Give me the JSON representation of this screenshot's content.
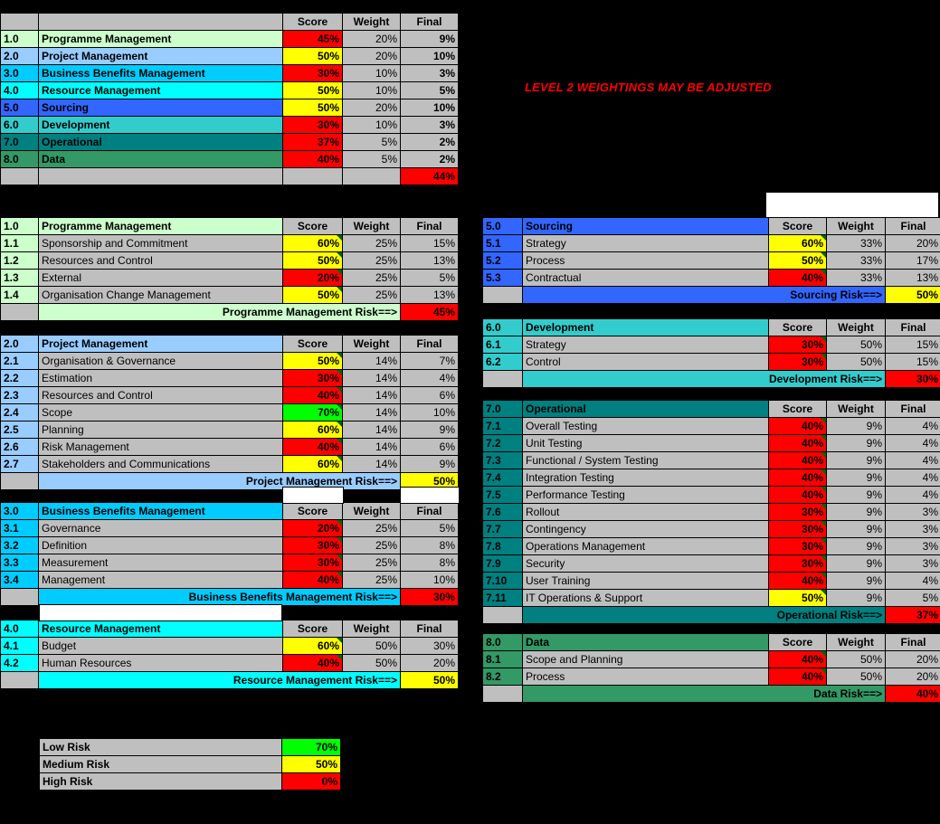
{
  "note": {
    "text": "LEVEL 2 WEIGHTINGS MAY BE ADJUSTED",
    "color": "#FF0000"
  },
  "columns": {
    "score": "Score",
    "weight": "Weight",
    "final": "Final"
  },
  "summary": {
    "headers": [
      "Score",
      "Weight",
      "Final"
    ],
    "rows": [
      {
        "num": "1.0",
        "name": "Programme Management",
        "score": "45%",
        "weight": "20%",
        "final": "9%",
        "score_color": "#FF0000",
        "row_color": "#CCFFCC"
      },
      {
        "num": "2.0",
        "name": "Project Management",
        "score": "50%",
        "weight": "20%",
        "final": "10%",
        "score_color": "#FFFF00",
        "row_color": "#99CCFF"
      },
      {
        "num": "3.0",
        "name": "Business Benefits Management",
        "score": "30%",
        "weight": "10%",
        "final": "3%",
        "score_color": "#FF0000",
        "row_color": "#00CCFF"
      },
      {
        "num": "4.0",
        "name": "Resource Management",
        "score": "50%",
        "weight": "10%",
        "final": "5%",
        "score_color": "#FFFF00",
        "row_color": "#00FFFF"
      },
      {
        "num": "5.0",
        "name": "Sourcing",
        "score": "50%",
        "weight": "20%",
        "final": "10%",
        "score_color": "#FFFF00",
        "row_color": "#3366FF"
      },
      {
        "num": "6.0",
        "name": "Development",
        "score": "30%",
        "weight": "10%",
        "final": "3%",
        "score_color": "#FF0000",
        "row_color": "#33CCCC"
      },
      {
        "num": "7.0",
        "name": "Operational",
        "score": "37%",
        "weight": "5%",
        "final": "2%",
        "score_color": "#FF0000",
        "row_color": "#008080"
      },
      {
        "num": "8.0",
        "name": "Data",
        "score": "40%",
        "weight": "5%",
        "final": "2%",
        "score_color": "#FF0000",
        "row_color": "#339966"
      }
    ],
    "total": {
      "value": "44%",
      "color": "#FF0000"
    }
  },
  "sections": [
    {
      "num": "1.0",
      "title": "Programme Management",
      "accent": "#CCFFCC",
      "rows": [
        {
          "num": "1.1",
          "name": "Sponsorship and Commitment",
          "score": "60%",
          "weight": "25%",
          "final": "15%",
          "score_color": "#FFFF00"
        },
        {
          "num": "1.2",
          "name": "Resources and Control",
          "score": "50%",
          "weight": "25%",
          "final": "13%",
          "score_color": "#FFFF00"
        },
        {
          "num": "1.3",
          "name": "External",
          "score": "20%",
          "weight": "25%",
          "final": "5%",
          "score_color": "#FF0000"
        },
        {
          "num": "1.4",
          "name": "Organisation Change Management",
          "score": "50%",
          "weight": "25%",
          "final": "13%",
          "score_color": "#FFFF00"
        }
      ],
      "footer": {
        "label": "Programme Management Risk==>",
        "value": "45%",
        "color": "#FF0000"
      }
    },
    {
      "num": "2.0",
      "title": "Project Management",
      "accent": "#99CCFF",
      "rows": [
        {
          "num": "2.1",
          "name": "Organisation & Governance",
          "score": "50%",
          "weight": "14%",
          "final": "7%",
          "score_color": "#FFFF00"
        },
        {
          "num": "2.2",
          "name": "Estimation",
          "score": "30%",
          "weight": "14%",
          "final": "4%",
          "score_color": "#FF0000"
        },
        {
          "num": "2.3",
          "name": "Resources and Control",
          "score": "40%",
          "weight": "14%",
          "final": "6%",
          "score_color": "#FF0000"
        },
        {
          "num": "2.4",
          "name": "Scope",
          "score": "70%",
          "weight": "14%",
          "final": "10%",
          "score_color": "#00FF00"
        },
        {
          "num": "2.5",
          "name": "Planning",
          "score": "60%",
          "weight": "14%",
          "final": "9%",
          "score_color": "#FFFF00"
        },
        {
          "num": "2.6",
          "name": "Risk Management",
          "score": "40%",
          "weight": "14%",
          "final": "6%",
          "score_color": "#FF0000"
        },
        {
          "num": "2.7",
          "name": "Stakeholders and Communications",
          "score": "60%",
          "weight": "14%",
          "final": "9%",
          "score_color": "#FFFF00"
        }
      ],
      "footer": {
        "label": "Project Management Risk==>",
        "value": "50%",
        "color": "#FFFF00"
      }
    },
    {
      "num": "3.0",
      "title": "Business Benefits Management",
      "accent": "#00CCFF",
      "rows": [
        {
          "num": "3.1",
          "name": "Governance",
          "score": "20%",
          "weight": "25%",
          "final": "5%",
          "score_color": "#FF0000"
        },
        {
          "num": "3.2",
          "name": "Definition",
          "score": "30%",
          "weight": "25%",
          "final": "8%",
          "score_color": "#FF0000"
        },
        {
          "num": "3.3",
          "name": "Measurement",
          "score": "30%",
          "weight": "25%",
          "final": "8%",
          "score_color": "#FF0000"
        },
        {
          "num": "3.4",
          "name": "Management",
          "score": "40%",
          "weight": "25%",
          "final": "10%",
          "score_color": "#FF0000"
        }
      ],
      "footer": {
        "label": "Business Benefits Management Risk==>",
        "value": "30%",
        "color": "#FF0000"
      }
    },
    {
      "num": "4.0",
      "title": "Resource Management",
      "accent": "#00FFFF",
      "rows": [
        {
          "num": "4.1",
          "name": "Budget",
          "score": "60%",
          "weight": "50%",
          "final": "30%",
          "score_color": "#FFFF00"
        },
        {
          "num": "4.2",
          "name": "Human Resources",
          "score": "40%",
          "weight": "50%",
          "final": "20%",
          "score_color": "#FF0000"
        }
      ],
      "footer": {
        "label": "Resource Management Risk==>",
        "value": "50%",
        "color": "#FFFF00"
      }
    },
    {
      "num": "5.0",
      "title": "Sourcing",
      "accent": "#3366FF",
      "rows": [
        {
          "num": "5.1",
          "name": "Strategy",
          "score": "60%",
          "weight": "33%",
          "final": "20%",
          "score_color": "#FFFF00"
        },
        {
          "num": "5.2",
          "name": "Process",
          "score": "50%",
          "weight": "33%",
          "final": "17%",
          "score_color": "#FFFF00"
        },
        {
          "num": "5.3",
          "name": "Contractual",
          "score": "40%",
          "weight": "33%",
          "final": "13%",
          "score_color": "#FF0000"
        }
      ],
      "footer": {
        "label": "Sourcing Risk==>",
        "value": "50%",
        "color": "#FFFF00"
      }
    },
    {
      "num": "6.0",
      "title": "Development",
      "accent": "#33CCCC",
      "rows": [
        {
          "num": "6.1",
          "name": "Strategy",
          "score": "30%",
          "weight": "50%",
          "final": "15%",
          "score_color": "#FF0000"
        },
        {
          "num": "6.2",
          "name": "Control",
          "score": "30%",
          "weight": "50%",
          "final": "15%",
          "score_color": "#FF0000"
        }
      ],
      "footer": {
        "label": "Development Risk==>",
        "value": "30%",
        "color": "#FF0000"
      }
    },
    {
      "num": "7.0",
      "title": "Operational",
      "accent": "#008080",
      "rows": [
        {
          "num": "7.1",
          "name": "Overall Testing",
          "score": "40%",
          "weight": "9%",
          "final": "4%",
          "score_color": "#FF0000"
        },
        {
          "num": "7.2",
          "name": "Unit Testing",
          "score": "40%",
          "weight": "9%",
          "final": "4%",
          "score_color": "#FF0000"
        },
        {
          "num": "7.3",
          "name": "Functional / System Testing",
          "score": "40%",
          "weight": "9%",
          "final": "4%",
          "score_color": "#FF0000"
        },
        {
          "num": "7.4",
          "name": "Integration Testing",
          "score": "40%",
          "weight": "9%",
          "final": "4%",
          "score_color": "#FF0000"
        },
        {
          "num": "7.5",
          "name": "Performance Testing",
          "score": "40%",
          "weight": "9%",
          "final": "4%",
          "score_color": "#FF0000"
        },
        {
          "num": "7.6",
          "name": "Rollout",
          "score": "30%",
          "weight": "9%",
          "final": "3%",
          "score_color": "#FF0000"
        },
        {
          "num": "7.7",
          "name": "Contingency",
          "score": "30%",
          "weight": "9%",
          "final": "3%",
          "score_color": "#FF0000"
        },
        {
          "num": "7.8",
          "name": "Operations Management",
          "score": "30%",
          "weight": "9%",
          "final": "3%",
          "score_color": "#FF0000"
        },
        {
          "num": "7.9",
          "name": "Security",
          "score": "30%",
          "weight": "9%",
          "final": "3%",
          "score_color": "#FF0000"
        },
        {
          "num": "7.10",
          "name": "User Training",
          "score": "40%",
          "weight": "9%",
          "final": "4%",
          "score_color": "#FF0000"
        },
        {
          "num": "7.11",
          "name": "IT Operations & Support",
          "score": "50%",
          "weight": "9%",
          "final": "5%",
          "score_color": "#FFFF00"
        }
      ],
      "footer": {
        "label": "Operational Risk==>",
        "value": "37%",
        "color": "#FF0000"
      }
    },
    {
      "num": "8.0",
      "title": "Data",
      "accent": "#339966",
      "rows": [
        {
          "num": "8.1",
          "name": "Scope and Planning",
          "score": "40%",
          "weight": "50%",
          "final": "20%",
          "score_color": "#FF0000"
        },
        {
          "num": "8.2",
          "name": "Process",
          "score": "40%",
          "weight": "50%",
          "final": "20%",
          "score_color": "#FF0000"
        }
      ],
      "footer": {
        "label": "Data Risk==>",
        "value": "40%",
        "color": "#FF0000"
      }
    }
  ],
  "legend": {
    "rows": [
      {
        "label": "Low Risk",
        "value": "70%",
        "color": "#00FF00"
      },
      {
        "label": "Medium Risk",
        "value": "50%",
        "color": "#FFFF00"
      },
      {
        "label": "High Risk",
        "value": "0%",
        "color": "#FF0000"
      }
    ]
  }
}
